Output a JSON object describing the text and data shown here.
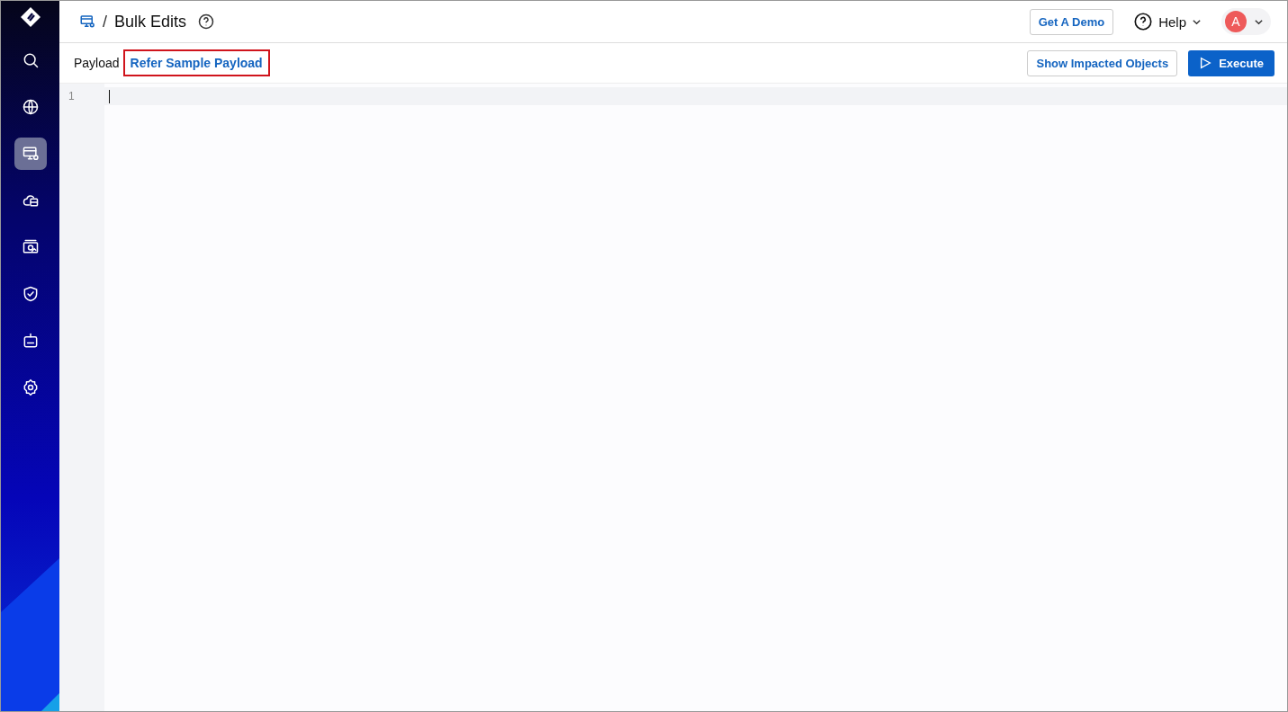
{
  "sidebar": {
    "items": [
      {
        "selected": false
      },
      {
        "selected": false
      },
      {
        "selected": true
      },
      {
        "selected": false
      },
      {
        "selected": false
      },
      {
        "selected": false
      },
      {
        "selected": false
      },
      {
        "selected": false
      }
    ]
  },
  "header": {
    "separator": "/",
    "title": "Bulk Edits",
    "demo_button": "Get A Demo",
    "help": "Help",
    "avatar": "A"
  },
  "toolbar": {
    "label": "Payload",
    "link": {
      "text": "Refer Sample Payload",
      "highlighted": true
    },
    "buttons": [
      {
        "label": "Show Impacted Objects",
        "kind": "secondary"
      },
      {
        "label": "Execute",
        "kind": "primary"
      }
    ]
  },
  "editor": {
    "lines": [
      "1"
    ]
  }
}
